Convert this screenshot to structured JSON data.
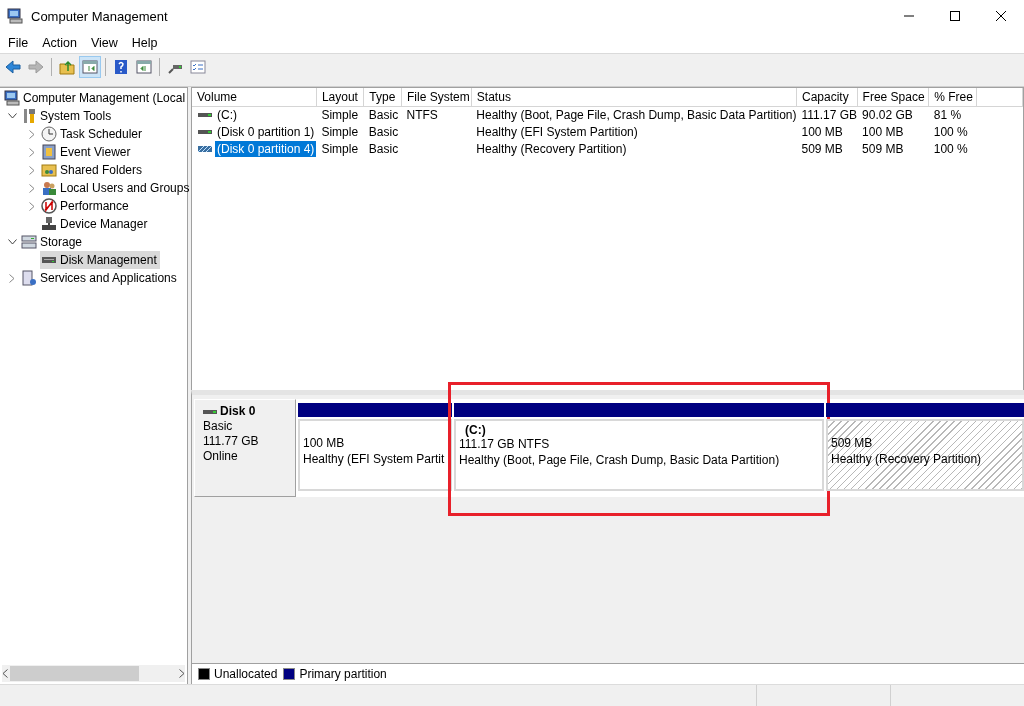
{
  "window": {
    "title": "Computer Management"
  },
  "menu": [
    "File",
    "Action",
    "View",
    "Help"
  ],
  "toolbar_buttons": [
    {
      "pressed": false,
      "disabled": false
    },
    {
      "pressed": false,
      "disabled": true
    },
    {
      "pressed": false,
      "disabled": false
    },
    {
      "pressed": true,
      "disabled": false
    },
    {
      "pressed": false,
      "disabled": false
    },
    {
      "pressed": false,
      "disabled": false
    },
    {
      "pressed": false,
      "disabled": false
    },
    {
      "pressed": false,
      "disabled": false
    }
  ],
  "tree": [
    {
      "label": "Computer Management (Local",
      "selected": false,
      "children": [
        {
          "label": "System Tools",
          "expanded": true,
          "selected": false,
          "children": [
            {
              "label": "Task Scheduler",
              "expanded": false,
              "selected": false
            },
            {
              "label": "Event Viewer",
              "expanded": false,
              "selected": false
            },
            {
              "label": "Shared Folders",
              "expanded": false,
              "selected": false
            },
            {
              "label": "Local Users and Groups",
              "expanded": false,
              "selected": false
            },
            {
              "label": "Performance",
              "expanded": false,
              "selected": false
            },
            {
              "label": "Device Manager",
              "selected": false
            }
          ]
        },
        {
          "label": "Storage",
          "expanded": true,
          "selected": false,
          "children": [
            {
              "label": "Disk Management",
              "selected": true
            }
          ]
        },
        {
          "label": "Services and Applications",
          "expanded": false,
          "selected": false
        }
      ]
    }
  ],
  "table": {
    "columns": [
      "Volume",
      "Layout",
      "Type",
      "File System",
      "Status",
      "Capacity",
      "Free Space",
      "% Free"
    ],
    "rows": [
      {
        "volume": "(C:)",
        "layout": "Simple",
        "type": "Basic",
        "file_system": "NTFS",
        "status": "Healthy (Boot, Page File, Crash Dump, Basic Data Partition)",
        "capacity": "111.17 GB",
        "free_space": "90.02 GB",
        "percent_free": "81 %",
        "selected": false
      },
      {
        "volume": "(Disk 0 partition 1)",
        "layout": "Simple",
        "type": "Basic",
        "file_system": "",
        "status": "Healthy (EFI System Partition)",
        "capacity": "100 MB",
        "free_space": "100 MB",
        "percent_free": "100 %",
        "selected": false
      },
      {
        "volume": "(Disk 0 partition 4)",
        "layout": "Simple",
        "type": "Basic",
        "file_system": "",
        "status": "Healthy (Recovery Partition)",
        "capacity": "509 MB",
        "free_space": "509 MB",
        "percent_free": "100 %",
        "selected": true
      }
    ]
  },
  "disk": {
    "name": "Disk 0",
    "type": "Basic",
    "size": "111.77 GB",
    "state": "Online",
    "partitions": [
      {
        "size": "100 MB",
        "status": "Healthy (EFI System Partit",
        "selected": false,
        "highlighted": false
      },
      {
        "label": "(C:)",
        "size": "111.17 GB NTFS",
        "status": "Healthy (Boot, Page File, Crash Dump, Basic Data Partition)",
        "selected": false,
        "highlighted": true
      },
      {
        "size": "509 MB",
        "status": "Healthy (Recovery Partition)",
        "selected": true,
        "highlighted": false
      }
    ]
  },
  "legend": [
    {
      "label": "Unallocated",
      "color": "#000000"
    },
    {
      "label": "Primary partition",
      "color": "#000080"
    }
  ]
}
